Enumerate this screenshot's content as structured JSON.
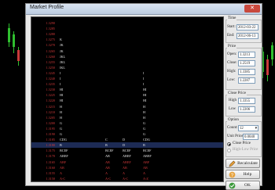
{
  "window": {
    "title": "Market Profile",
    "close_glyph": "✕"
  },
  "profile": {
    "prices": [
      "1.3290",
      "1.3285",
      "1.3280",
      "1.3275",
      "1.3270",
      "1.3265",
      "1.3260",
      "1.3255",
      "1.3250",
      "1.3245",
      "1.3240",
      "1.3235",
      "1.3230",
      "1.3225",
      "1.3220",
      "1.3215",
      "1.3210",
      "1.3205",
      "1.3200",
      "1.3195",
      "1.3190",
      "1.3185",
      "1.3180",
      "1.3175",
      "1.3170",
      "1.3165",
      "1.3160",
      "1.3155",
      "1.3150"
    ],
    "col1": [
      "K",
      "JK",
      "JK",
      "JKL",
      "JKL",
      "IKL",
      "I",
      "I",
      "I",
      "HI",
      "HI",
      "HI",
      "H",
      "H",
      "H",
      "G",
      "G",
      "G",
      "CDG",
      "B",
      "BCEF",
      "ABEF",
      "ABF",
      "AB",
      "A",
      "A-C"
    ],
    "col2": [
      "",
      "",
      "",
      "",
      "",
      "",
      "",
      "",
      "",
      "",
      "",
      "",
      "",
      "",
      "",
      "",
      "",
      "",
      "C",
      "B",
      "BCEF",
      "AB",
      "AB",
      "AB",
      "A",
      "A-C"
    ],
    "col3": [
      "",
      "",
      "",
      "",
      "",
      "",
      "",
      "",
      "",
      "",
      "",
      "",
      "",
      "",
      "",
      "",
      "",
      "",
      "D",
      "D",
      "BCEF",
      "ABEF",
      "ABEF",
      "AB",
      "A",
      "A-C"
    ],
    "col4": [
      "",
      "",
      "",
      "",
      "",
      "",
      "I",
      "I",
      "I",
      "HI",
      "HI",
      "HI",
      "H",
      "H",
      "H",
      "G",
      "G",
      "G",
      "CDG",
      "B",
      "BCEF",
      "ABEF",
      "ABF",
      "AB",
      "A",
      "A-Z"
    ]
  },
  "side": {
    "time_label": "Time",
    "start_label": "Start:",
    "start_value": "2012-03-22",
    "end_label": "End:",
    "end_value": "2012-06-13",
    "price_label": "Price",
    "open_label": "Open:",
    "open_value": "1.3213",
    "close_label": "Close:",
    "close_value": "1.2519",
    "high_label": "High:",
    "high_value": "1.3385",
    "low_label": "Low:",
    "low_value": "1.2287",
    "cp_label": "Close Price",
    "cp_high_label": "High",
    "cp_high_value": "1.3355",
    "cp_low_label": "Low",
    "cp_low_value": "1.2206",
    "option_label": "Option",
    "count_label": "Count:",
    "count_value": "12",
    "unit_label": "Unit Price:",
    "unit_value": "0.0040",
    "radio_close": "Close Price",
    "radio_hl": "High-Low Price",
    "recalc_label": "Recalculate",
    "help_label": "Help",
    "ok_label": "OK"
  }
}
